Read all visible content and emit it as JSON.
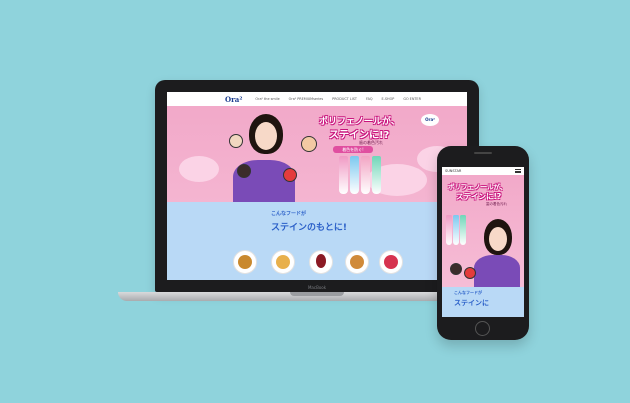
{
  "desktop": {
    "logo": "Ora²",
    "nav": [
      "Ora² the smile",
      "Ora² PREMIUMseries",
      "PRODUCT LIST",
      "FAQ",
      "E-SHOP",
      "GO ENTER"
    ],
    "hero": {
      "headline_1": "ポリフェノールが、",
      "headline_2": "ステインに!?",
      "sub": "歯の着色汚れ",
      "badge": "着色を防ぐ!",
      "products_logo": "Ora²"
    },
    "features": {
      "title_1": "こんなフードが",
      "title_2": "ステインのもとに!"
    },
    "laptop_brand": "MacBook"
  },
  "mobile": {
    "brand": "SUNSTAR",
    "hero": {
      "headline_1": "ポリフェノールが、",
      "headline_2": "ステインに!?",
      "sub": "歯の着色汚れ"
    },
    "features": {
      "title_1": "こんなフードが",
      "title_2": "ステインに"
    }
  },
  "colors": {
    "background": "#8fd3dc",
    "hero_pink": "#f2a9c9",
    "features_blue": "#b9d9f6",
    "accent_magenta": "#c8127c",
    "title_blue": "#2a5fc8"
  }
}
